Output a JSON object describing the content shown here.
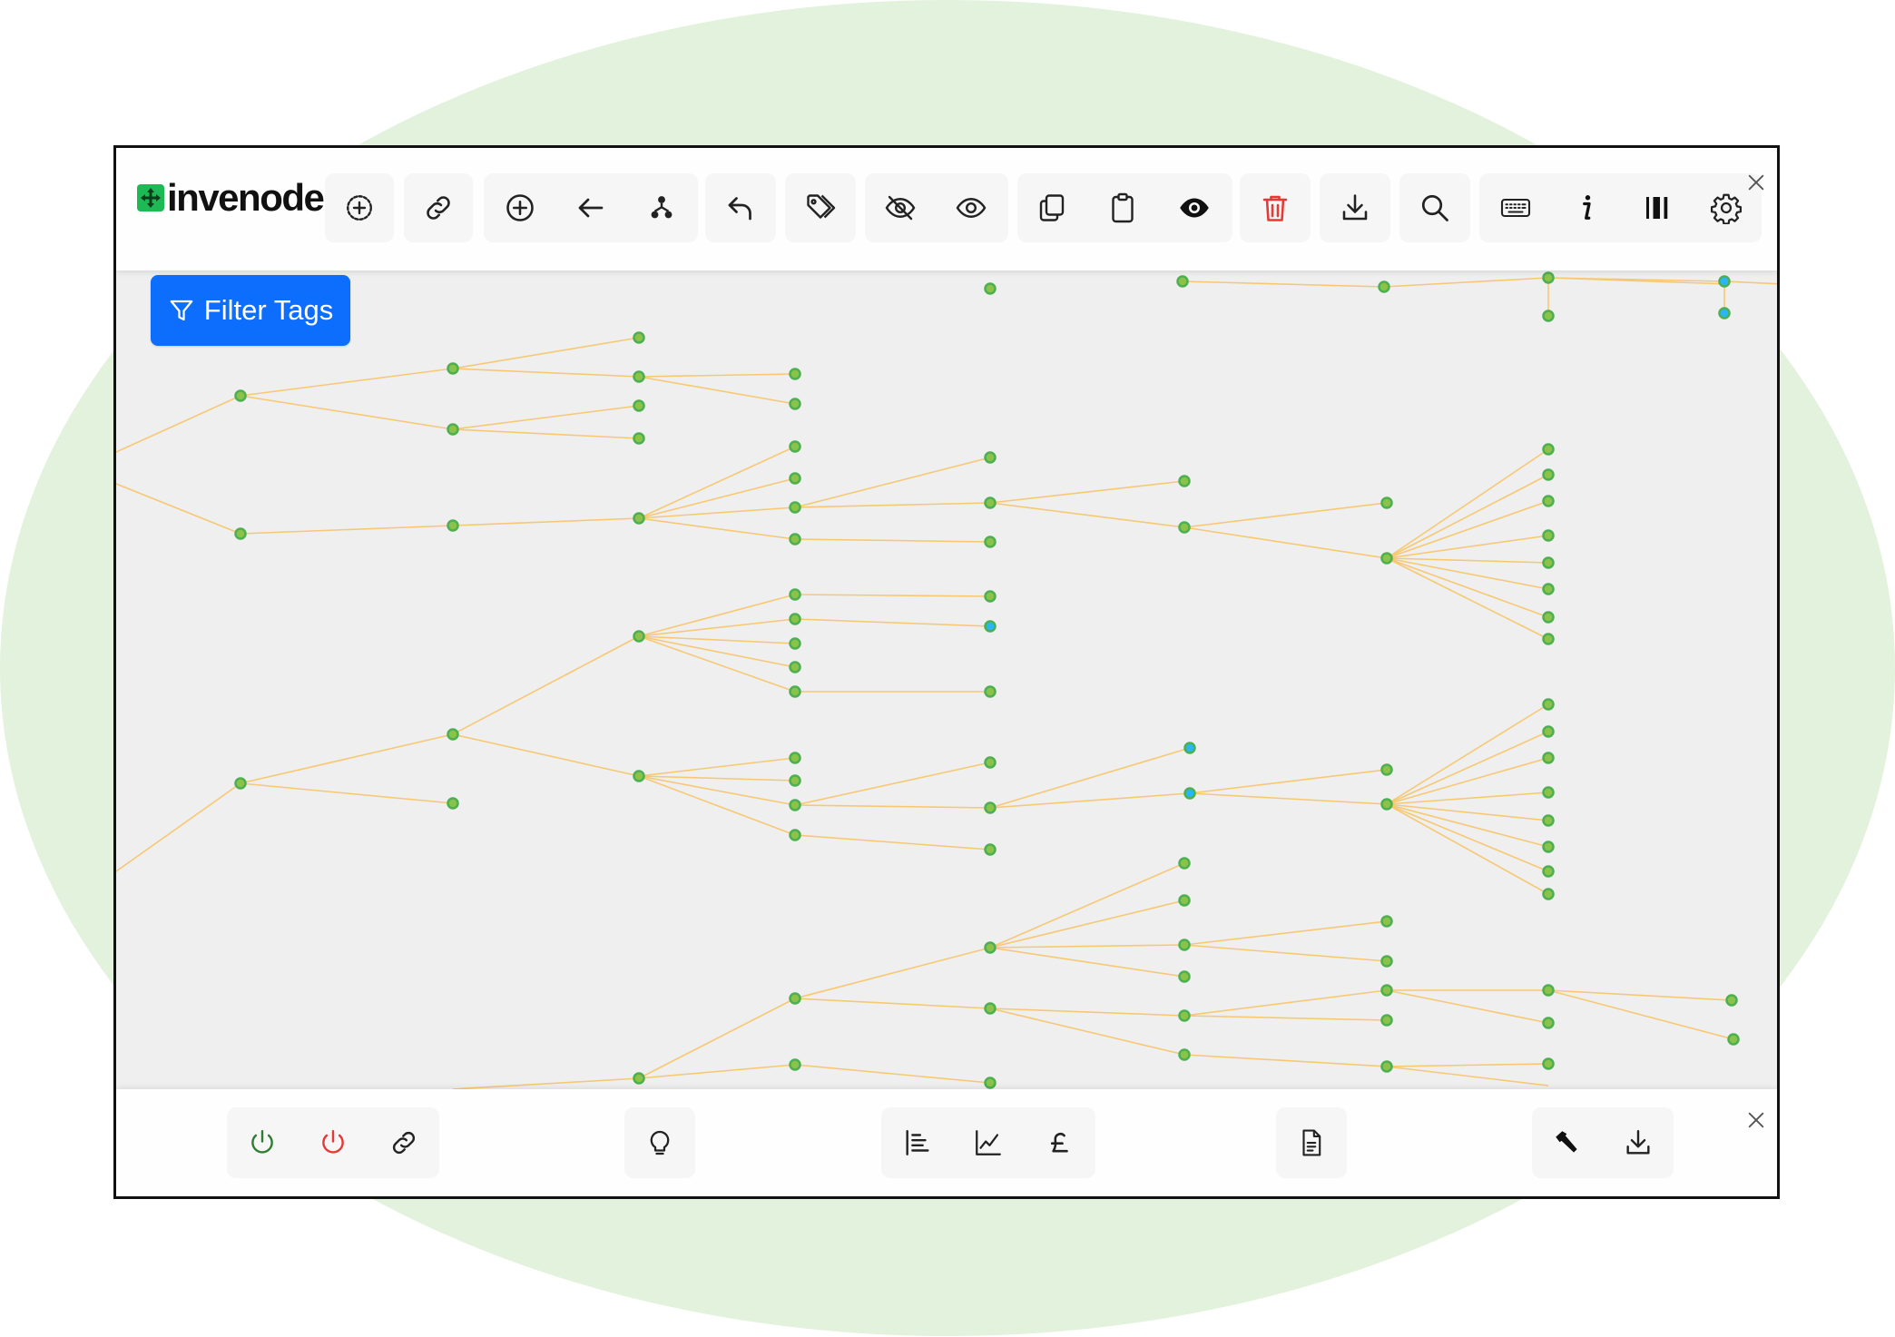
{
  "app": {
    "logo_text": "invenode",
    "brand_color": "#1db954",
    "filter_button_label": "Filter Tags",
    "filter_button_color": "#0d6efd"
  },
  "toolbar": {
    "icons": [
      "add-circle-dashed-icon",
      "link-icon",
      "add-circle-icon",
      "arrow-left-icon",
      "hierarchy-icon",
      "undo-icon",
      "tags-icon",
      "eye-slash-icon",
      "eye-icon",
      "copy-icon",
      "clipboard-icon",
      "eye-filled-icon",
      "trash-icon",
      "download-icon",
      "search-icon",
      "keyboard-icon",
      "info-icon",
      "columns-icon",
      "gear-icon",
      "close-icon"
    ]
  },
  "bottombar": {
    "icons": [
      "power-on-icon",
      "power-off-icon",
      "link-icon",
      "lightbulb-icon",
      "list-tree-icon",
      "line-chart-icon",
      "pound-icon",
      "document-icon",
      "hammer-icon",
      "download-icon",
      "close-icon"
    ]
  },
  "graph": {
    "node_color": "#8bc34a",
    "node_border": "#4caf50",
    "highlight_node_color": "#29b6f6",
    "edge_color": "#f7c873"
  }
}
